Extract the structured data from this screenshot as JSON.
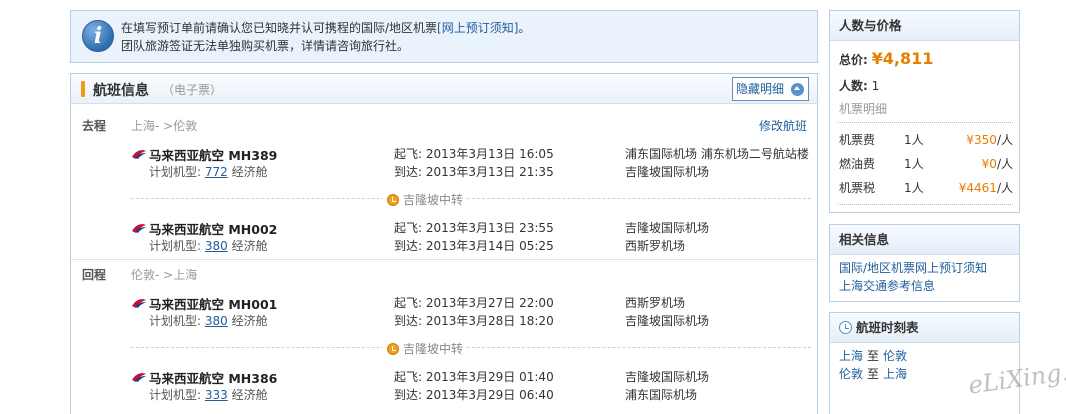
{
  "notice": {
    "line1": "在填写预订单前请确认您已知晓并认可携程的国际/地区机票",
    "link": "[网上预订须知]",
    "line1_end": "。",
    "line2": "团队旅游签证无法单独购买机票，详情请咨询旅行社。"
  },
  "flight_panel": {
    "title": "航班信息",
    "subtitle": "（电子票）",
    "hide_button": "隐藏明细",
    "outbound": {
      "label": "去程",
      "route": "上海- >伦敦",
      "modify": "修改航班",
      "segments": [
        {
          "airline": "马来西亚航空 MH389",
          "plane_prefix": "计划机型:",
          "plane_type": "772",
          "cabin": "经济舱",
          "depart": "起飞: 2013年3月13日 16:05",
          "arrive": "到达: 2013年3月13日 21:35",
          "from_airport": "浦东国际机场 浦东机场二号航站楼",
          "to_airport": "吉隆坡国际机场"
        },
        {
          "airline": "马来西亚航空 MH002",
          "plane_prefix": "计划机型:",
          "plane_type": "380",
          "cabin": "经济舱",
          "depart": "起飞: 2013年3月13日 23:55",
          "arrive": "到达: 2013年3月14日 05:25",
          "from_airport": "吉隆坡国际机场",
          "to_airport": "西斯罗机场"
        }
      ],
      "transfer": "吉隆坡中转"
    },
    "return": {
      "label": "回程",
      "route": "伦敦- >上海",
      "segments": [
        {
          "airline": "马来西亚航空 MH001",
          "plane_prefix": "计划机型:",
          "plane_type": "380",
          "cabin": "经济舱",
          "depart": "起飞: 2013年3月27日 22:00",
          "arrive": "到达: 2013年3月28日 18:20",
          "from_airport": "西斯罗机场",
          "to_airport": "吉隆坡国际机场"
        },
        {
          "airline": "马来西亚航空 MH386",
          "plane_prefix": "计划机型:",
          "plane_type": "333",
          "cabin": "经济舱",
          "depart": "起飞: 2013年3月29日 01:40",
          "arrive": "到达: 2013年3月29日 06:40",
          "from_airport": "吉隆坡国际机场",
          "to_airport": "浦东国际机场"
        }
      ],
      "transfer": "吉隆坡中转"
    }
  },
  "price_box": {
    "title": "人数与价格",
    "total_label": "总价:",
    "total_value": "¥4,811",
    "count_label": "人数:",
    "count_value": "1",
    "detail_label": "机票明细",
    "fees": [
      {
        "name": "机票费",
        "count": "1人",
        "amount": "¥350",
        "unit": "/人"
      },
      {
        "name": "燃油费",
        "count": "1人",
        "amount": "¥0",
        "unit": "/人"
      },
      {
        "name": "机票税",
        "count": "1人",
        "amount": "¥4461",
        "unit": "/人"
      }
    ]
  },
  "related_box": {
    "title": "相关信息",
    "links": [
      "国际/地区机票网上预订须知",
      "上海交通参考信息"
    ]
  },
  "schedule_box": {
    "title": "航班时刻表",
    "rows": [
      {
        "from": "上海",
        "to_word": "至",
        "to": "伦敦"
      },
      {
        "from": "伦敦",
        "to_word": "至",
        "to": "上海"
      }
    ]
  },
  "watermark": "eLiXing.net",
  "colors": {
    "accent_orange": "#e67e00",
    "link_blue": "#1f5e9c",
    "border_blue": "#b7cfe6"
  }
}
